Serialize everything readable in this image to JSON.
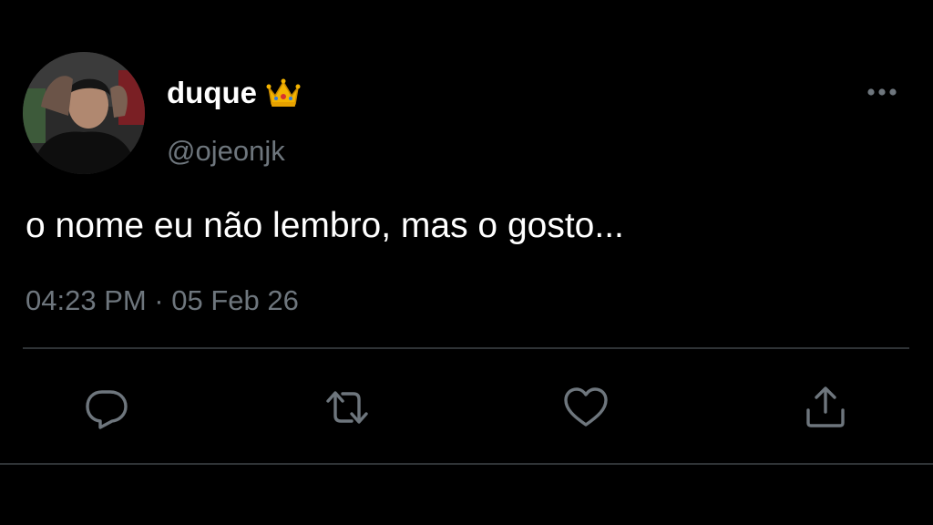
{
  "user": {
    "display_name": "duque",
    "handle": "@ojeonjk",
    "badge_icon": "crown-emoji"
  },
  "tweet": {
    "text": "o nome eu não lembro, mas o gosto...",
    "timestamp": "04:23 PM · 05 Feb 26"
  },
  "actions": [
    {
      "name": "reply",
      "icon": "reply-icon"
    },
    {
      "name": "retweet",
      "icon": "retweet-icon"
    },
    {
      "name": "like",
      "icon": "heart-icon"
    },
    {
      "name": "share",
      "icon": "share-icon"
    }
  ],
  "colors": {
    "background": "#000000",
    "primary_text": "#ffffff",
    "secondary_text": "#6e767d",
    "divider": "#2f3336"
  }
}
